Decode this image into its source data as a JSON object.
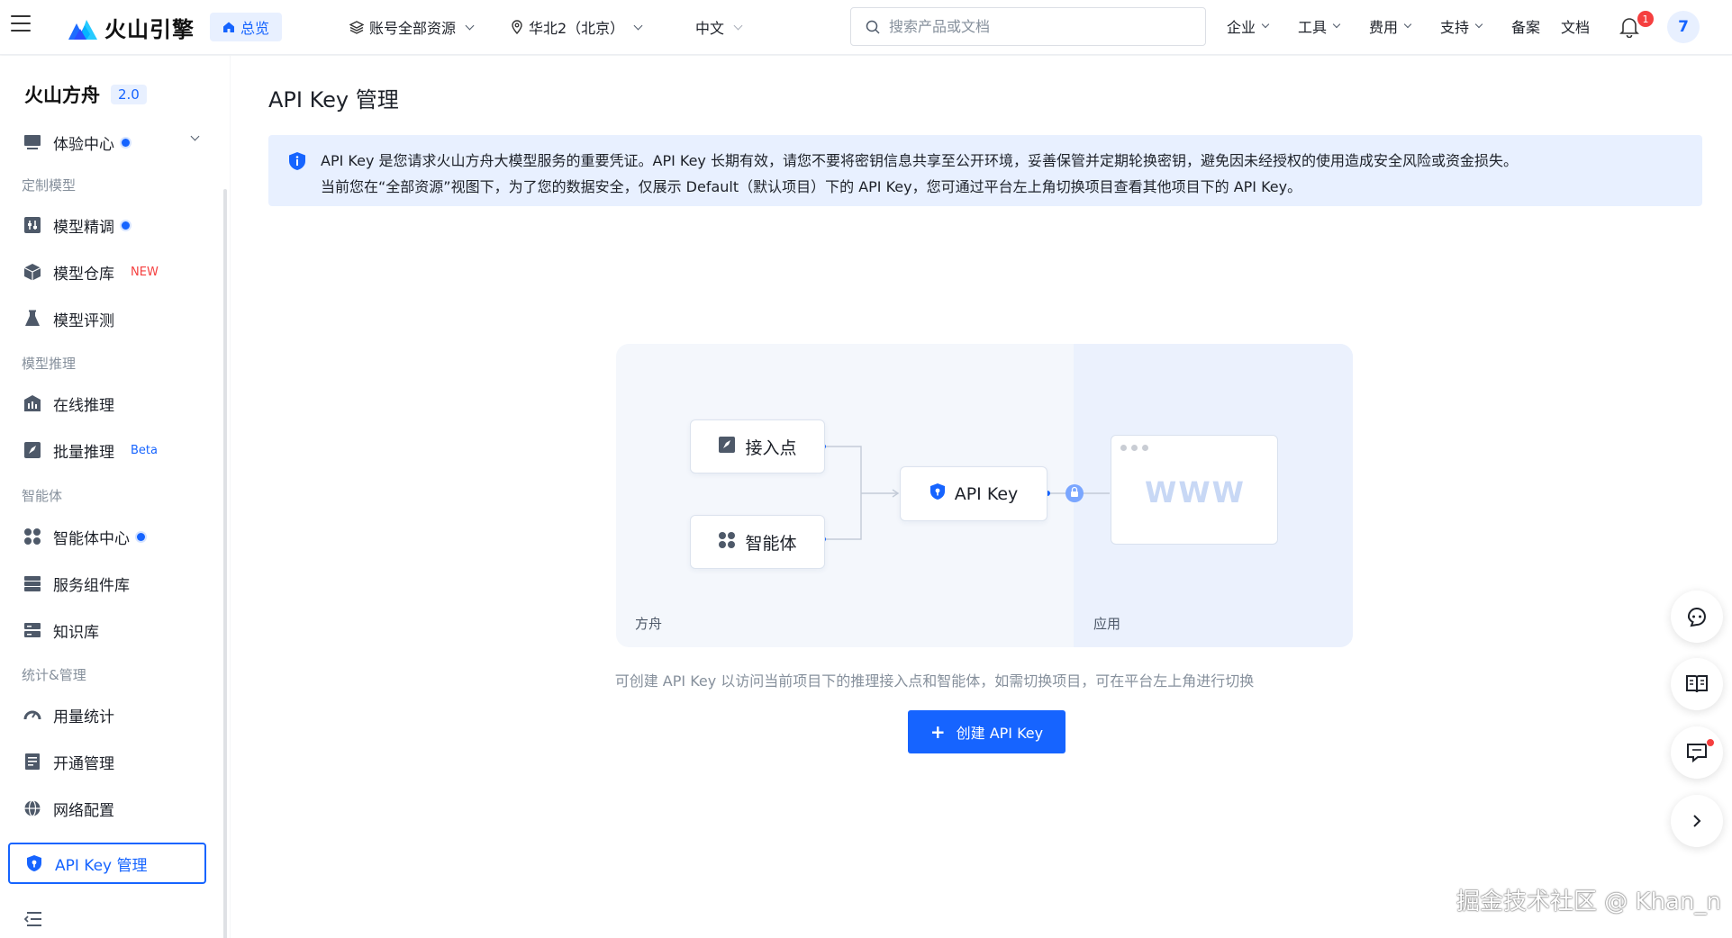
{
  "brand": {
    "name": "火山引擎"
  },
  "topbar": {
    "home_label": "总览",
    "account_scope": "账号全部资源",
    "region": "华北2（北京）",
    "language": "中文",
    "search_placeholder": "搜索产品或文档",
    "nav": [
      "企业",
      "工具",
      "费用",
      "支持",
      "备案",
      "文档"
    ],
    "notification_count": "1",
    "avatar_initial": "7"
  },
  "sidebar": {
    "title": "火山方舟",
    "version": "2.0",
    "experience_center": "体验中心",
    "groups": {
      "custom_models": "定制模型",
      "inference": "模型推理",
      "agents": "智能体",
      "stats_mgmt": "统计&管理"
    },
    "items": {
      "fine_tune": "模型精调",
      "model_repo": "模型仓库",
      "model_repo_tag": "NEW",
      "model_eval": "模型评测",
      "online_inference": "在线推理",
      "batch_inference": "批量推理",
      "batch_inference_tag": "Beta",
      "agent_center": "智能体中心",
      "service_components": "服务组件库",
      "knowledge_base": "知识库",
      "usage_stats": "用量统计",
      "activation_mgmt": "开通管理",
      "network_config": "网络配置",
      "api_key_mgmt": "API Key 管理"
    }
  },
  "main": {
    "title": "API Key 管理",
    "alert_line1": "API Key 是您请求火山方舟大模型服务的重要凭证。API Key 长期有效，请您不要将密钥信息共享至公开环境，妥善保管并定期轮换密钥，避免因未经授权的使用造成安全风险或资金损失。",
    "alert_line2": "当前您在“全部资源”视图下，为了您的数据安全，仅展示 Default（默认项目）下的 API Key，您可通过平台左上角切换项目查看其他项目下的 API Key。",
    "diagram": {
      "endpoint": "接入点",
      "agent": "智能体",
      "api_key": "API Key",
      "www": "WWW",
      "left_label": "方舟",
      "right_label": "应用"
    },
    "hint": "可创建 API Key 以访问当前项目下的推理接入点和智能体，如需切换项目，可在平台左上角进行切换",
    "create_button": "创建 API Key"
  },
  "watermark": "掘金技术社区 @ Khan_n",
  "colors": {
    "primary": "#1664ff",
    "alert_bg": "#e8f0ff",
    "danger": "#f53f3f"
  }
}
